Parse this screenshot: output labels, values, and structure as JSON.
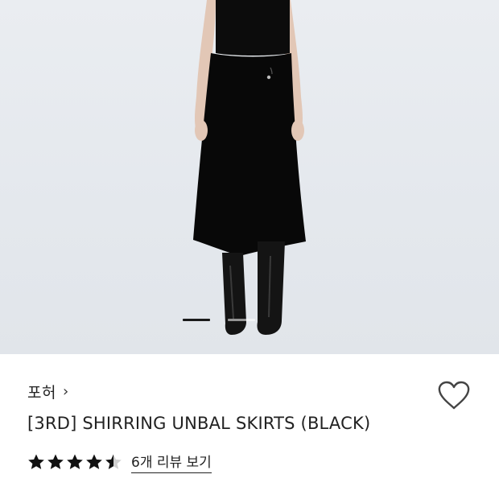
{
  "product": {
    "brand": "포허",
    "brand_chevron": "›",
    "title": "[3RD] SHIRRING UNBAL SKIRTS (BLACK)",
    "rating": 4.5,
    "review_link": "6개 리뷰 보기",
    "image_count": 2,
    "active_image": 1
  },
  "icons": {
    "wishlist": "heart-outline-icon",
    "star": "star-icon"
  },
  "colors": {
    "star": "#111111",
    "accent": "#111111"
  }
}
